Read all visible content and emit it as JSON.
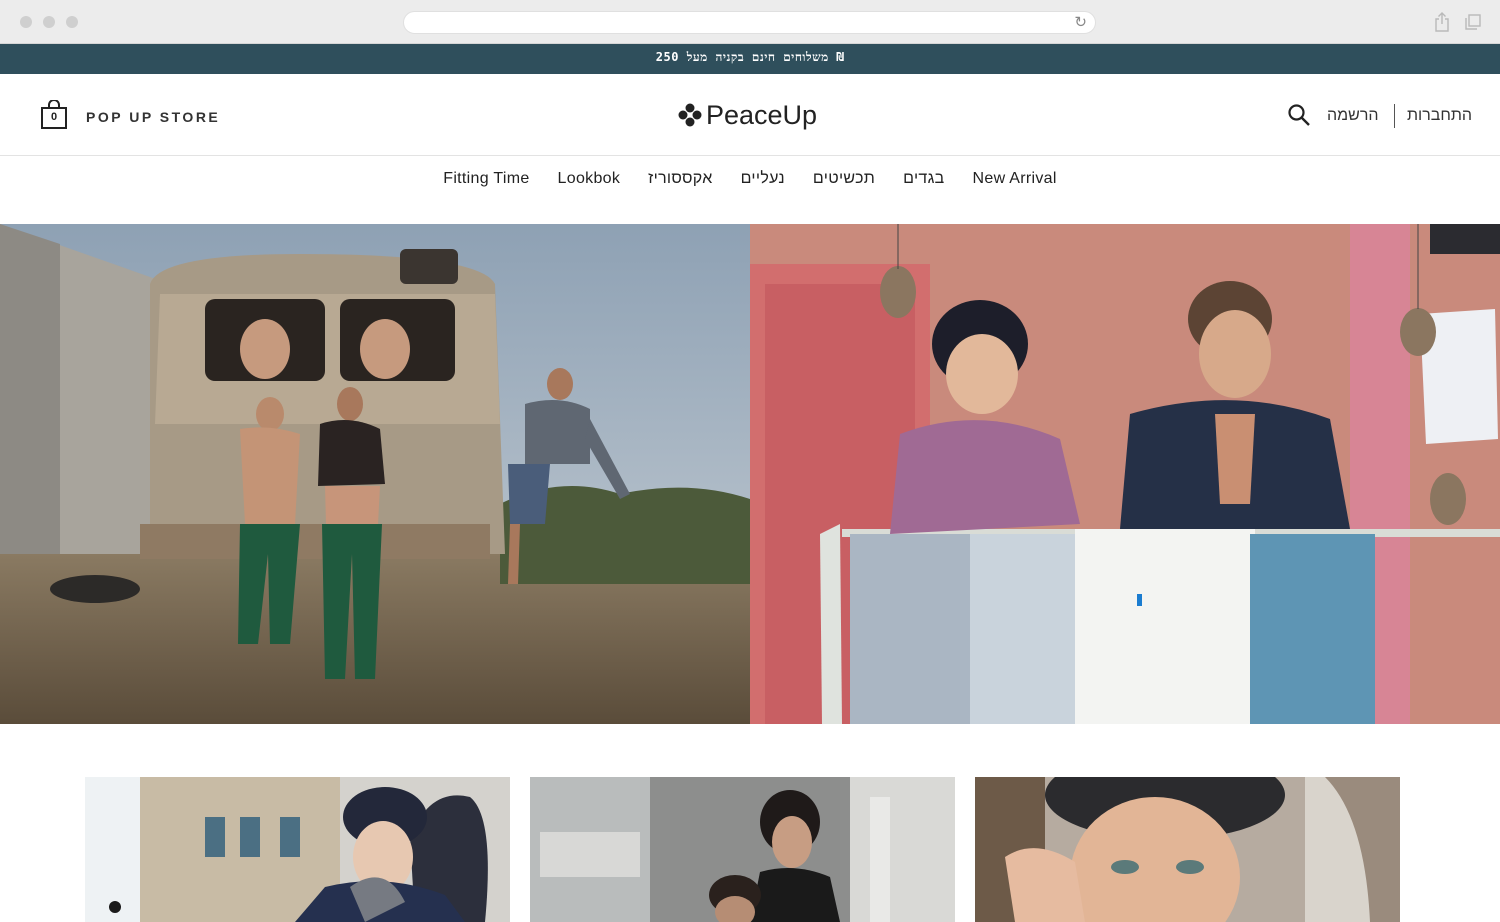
{
  "announcement": "משלוחים חינם בקניה מעל 250 ₪",
  "header": {
    "cart_count": "0",
    "store_label": "POP UP STORE",
    "logo_text": "PeaceUp",
    "register_label": "הרשמה",
    "login_label": "התחברות"
  },
  "nav": {
    "items": [
      "Fitting Time",
      "Lookbok",
      "אקססוריז",
      "נעליים",
      "תכשיטים",
      "בגדים",
      "New Arrival"
    ]
  },
  "icons": [
    "cart-icon",
    "logo-flower-icon",
    "search-icon",
    "reload-icon",
    "share-icon",
    "tabs-icon"
  ]
}
